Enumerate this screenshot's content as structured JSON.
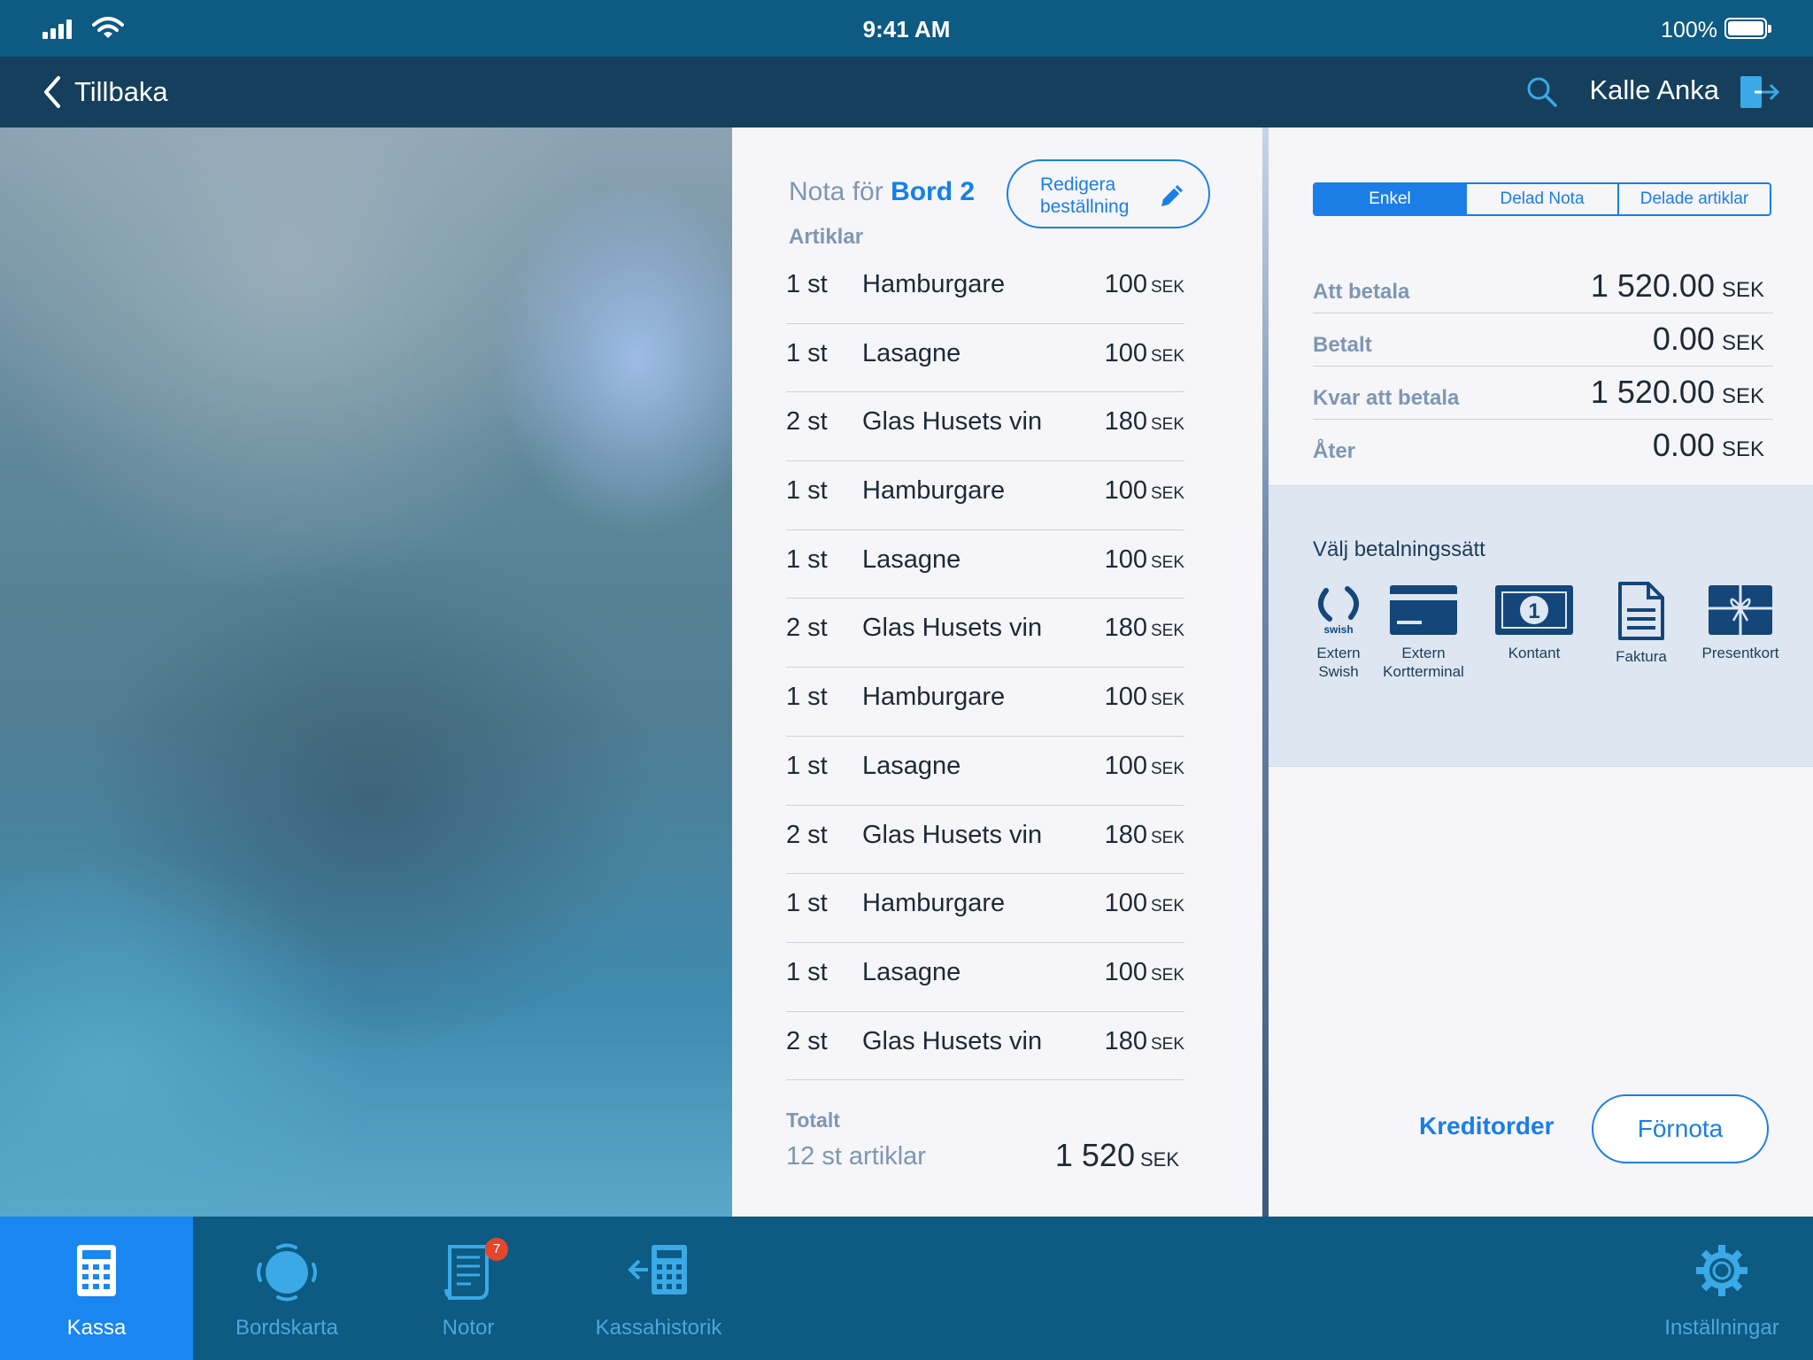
{
  "status": {
    "time": "9:41 AM",
    "battery": "100%"
  },
  "nav": {
    "back_label": "Tillbaka",
    "user_name": "Kalle Anka"
  },
  "receipt": {
    "title_prefix": "Nota för",
    "table_name": "Bord 2",
    "edit_label_line1": "Redigera",
    "edit_label_line2": "beställning",
    "section_label": "Artiklar",
    "items": [
      {
        "qty": "1 st",
        "name": "Hamburgare",
        "price": "100",
        "currency": "SEK"
      },
      {
        "qty": "1 st",
        "name": "Lasagne",
        "price": "100",
        "currency": "SEK"
      },
      {
        "qty": "2 st",
        "name": "Glas Husets vin",
        "price": "180",
        "currency": "SEK"
      },
      {
        "qty": "1 st",
        "name": "Hamburgare",
        "price": "100",
        "currency": "SEK"
      },
      {
        "qty": "1 st",
        "name": "Lasagne",
        "price": "100",
        "currency": "SEK"
      },
      {
        "qty": "2 st",
        "name": "Glas Husets vin",
        "price": "180",
        "currency": "SEK"
      },
      {
        "qty": "1 st",
        "name": "Hamburgare",
        "price": "100",
        "currency": "SEK"
      },
      {
        "qty": "1 st",
        "name": "Lasagne",
        "price": "100",
        "currency": "SEK"
      },
      {
        "qty": "2 st",
        "name": "Glas Husets vin",
        "price": "180",
        "currency": "SEK"
      },
      {
        "qty": "1 st",
        "name": "Hamburgare",
        "price": "100",
        "currency": "SEK"
      },
      {
        "qty": "1 st",
        "name": "Lasagne",
        "price": "100",
        "currency": "SEK"
      },
      {
        "qty": "2 st",
        "name": "Glas Husets vin",
        "price": "180",
        "currency": "SEK"
      }
    ],
    "total_label": "Totalt",
    "total_count": "12 st artiklar",
    "total_amount": "1 520",
    "total_currency": "SEK"
  },
  "payment": {
    "segments": [
      "Enkel",
      "Delad Nota",
      "Delade artiklar"
    ],
    "active_segment": 0,
    "summary": [
      {
        "label": "Att betala",
        "value": "1 520.00",
        "currency": "SEK"
      },
      {
        "label": "Betalt",
        "value": "0.00",
        "currency": "SEK"
      },
      {
        "label": "Kvar att betala",
        "value": "1 520.00",
        "currency": "SEK"
      },
      {
        "label": "Åter",
        "value": "0.00",
        "currency": "SEK"
      }
    ],
    "methods_heading": "Välj betalningssätt",
    "methods": [
      {
        "icon": "swish-icon",
        "brand_text": "swish",
        "line1": "Extern",
        "line2": "Swish"
      },
      {
        "icon": "card-terminal-icon",
        "line1": "Extern",
        "line2": "Kortterminal"
      },
      {
        "icon": "cash-icon",
        "line1": "Kontant",
        "line2": ""
      },
      {
        "icon": "invoice-icon",
        "line1": "Faktura",
        "line2": ""
      },
      {
        "icon": "gift-card-icon",
        "line1": "Presentkort",
        "line2": ""
      }
    ],
    "credit_label": "Kreditorder",
    "preliminary_label": "Förnota"
  },
  "tabs": [
    {
      "label": "Kassa",
      "icon": "calculator-icon",
      "active": true
    },
    {
      "label": "Bordskarta",
      "icon": "table-map-icon",
      "active": false
    },
    {
      "label": "Notor",
      "icon": "receipt-icon",
      "active": false,
      "badge": "7"
    },
    {
      "label": "Kassahistorik",
      "icon": "history-icon",
      "active": false
    },
    {
      "label": "Inställningar",
      "icon": "gear-icon",
      "active": false
    }
  ],
  "colors": {
    "accent": "#1a7ee6",
    "header": "#0d5a83",
    "navbar": "#153f5c",
    "panel": "#f6f5f8",
    "badge": "#e2462b"
  }
}
